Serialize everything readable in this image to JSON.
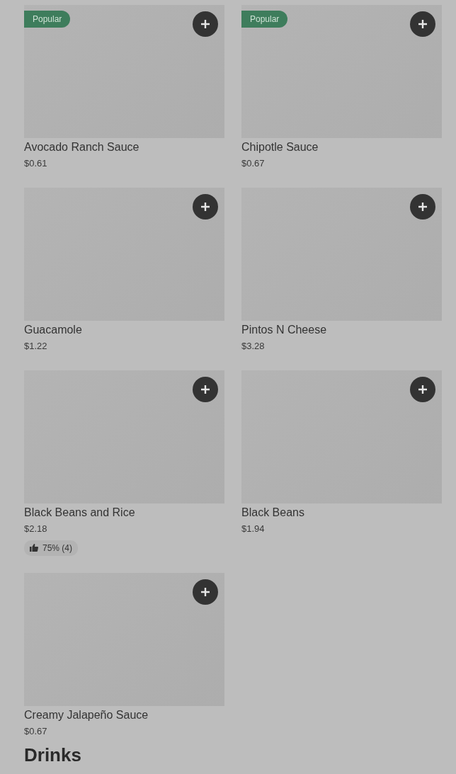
{
  "items": [
    {
      "name": "Avocado Ranch Sauce",
      "price": "$0.61",
      "badge": "Popular"
    },
    {
      "name": "Chipotle Sauce",
      "price": "$0.67",
      "badge": "Popular"
    },
    {
      "name": "Guacamole",
      "price": "$1.22"
    },
    {
      "name": "Pintos N Cheese",
      "price": "$3.28"
    },
    {
      "name": "Black Beans and Rice",
      "price": "$2.18",
      "rating": "75% (4)"
    },
    {
      "name": "Black Beans",
      "price": "$1.94"
    },
    {
      "name": "Creamy Jalapeño Sauce",
      "price": "$0.67"
    }
  ],
  "next_section": {
    "title": "Drinks"
  }
}
